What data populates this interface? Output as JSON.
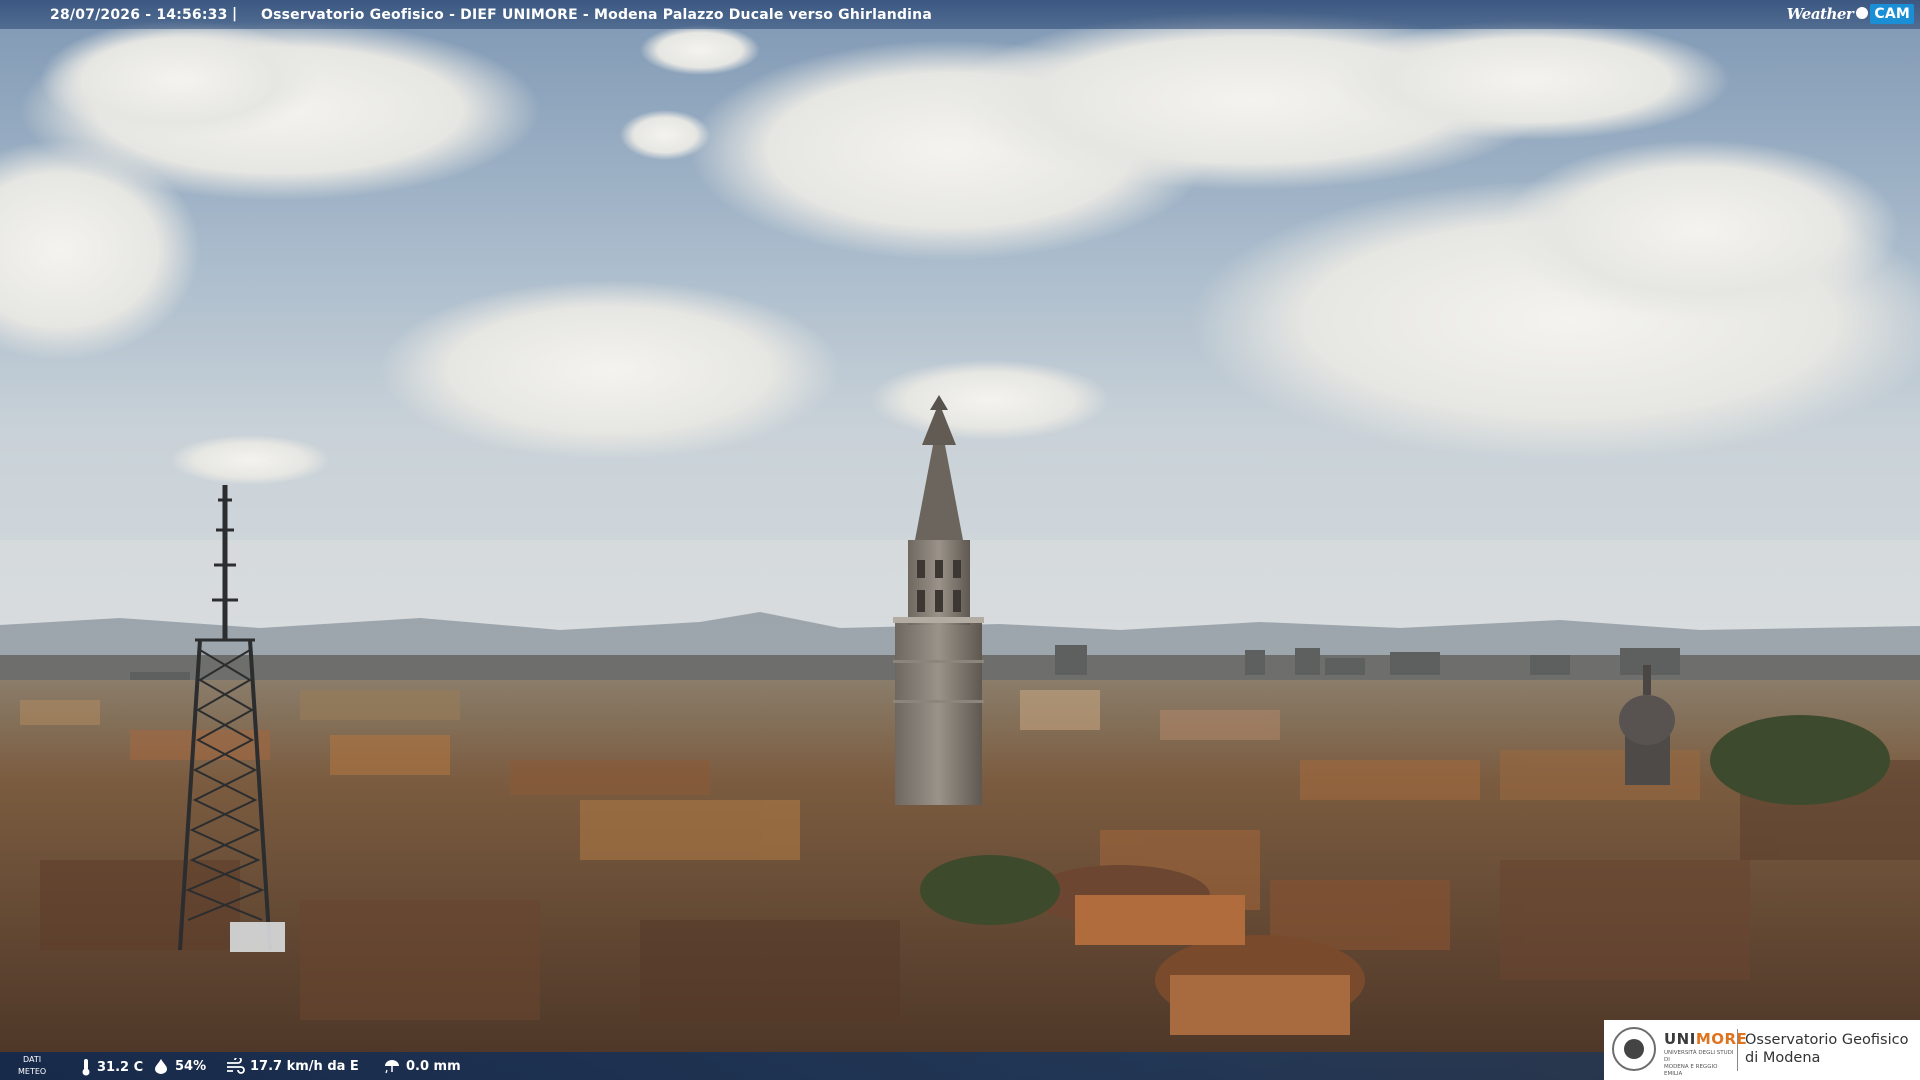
{
  "header": {
    "timestamp": "28/07/2026 - 14:56:33",
    "separator": "|",
    "title": "Osservatorio Geofisico - DIEF UNIMORE - Modena Palazzo Ducale verso Ghirlandina",
    "brand_weather": "Weather",
    "brand_cam": "CAM"
  },
  "weather": {
    "label_line1": "DATI",
    "label_line2": "METEO",
    "temperature": "31.2 C",
    "humidity": "54%",
    "wind": "17.7 km/h da E",
    "rain": "0.0 mm"
  },
  "logo": {
    "uni": "UNI",
    "more": "MORE",
    "university_line1": "UNIVERSITÀ DEGLI STUDI DI",
    "university_line2": "MODENA E REGGIO EMILIA",
    "observatory_line1": "Osservatorio Geofisico",
    "observatory_line2": "di Modena"
  },
  "colors": {
    "bar_blue": "#284673",
    "unimore_orange": "#e0731e",
    "cam_blue": "#1b8fd6"
  },
  "icons": [
    "thermometer-icon",
    "humidity-drop-icon",
    "wind-icon",
    "rain-gauge-icon"
  ]
}
